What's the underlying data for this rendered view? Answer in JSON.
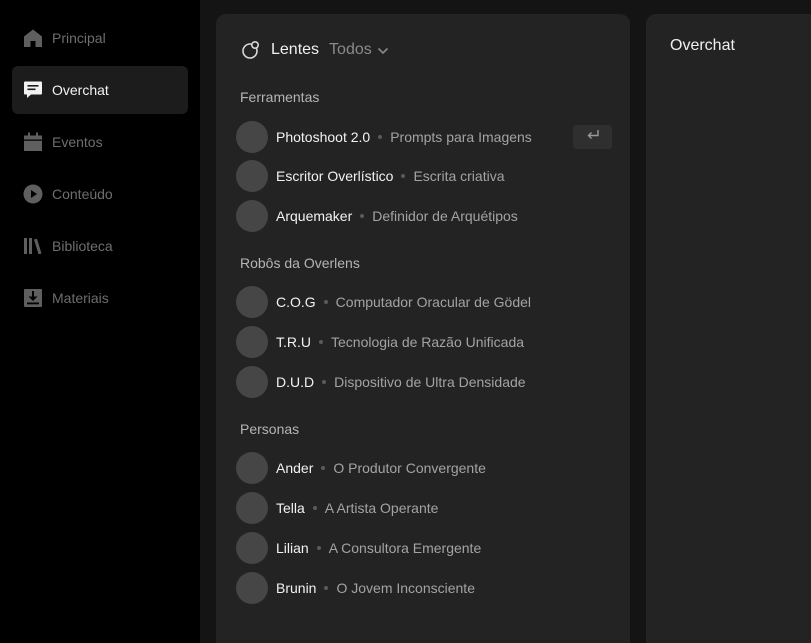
{
  "sidebar": {
    "items": [
      {
        "label": "Principal",
        "icon": "home-icon",
        "active": false
      },
      {
        "label": "Overchat",
        "icon": "chat-icon",
        "active": true
      },
      {
        "label": "Eventos",
        "icon": "calendar-icon",
        "active": false
      },
      {
        "label": "Conteúdo",
        "icon": "play-icon",
        "active": false
      },
      {
        "label": "Biblioteca",
        "icon": "library-icon",
        "active": false
      },
      {
        "label": "Materiais",
        "icon": "download-icon",
        "active": false
      }
    ]
  },
  "lentes": {
    "title": "Lentes",
    "filter": "Todos",
    "sections": [
      {
        "title": "Ferramentas",
        "items": [
          {
            "name": "Photoshoot 2.0",
            "desc": "Prompts para Imagens"
          },
          {
            "name": "Escritor Overlístico",
            "desc": "Escrita criativa"
          },
          {
            "name": "Arquemaker",
            "desc": "Definidor de Arquétipos"
          }
        ]
      },
      {
        "title": "Robôs da Overlens",
        "items": [
          {
            "name": "C.O.G",
            "desc": "Computador Oracular de Gödel"
          },
          {
            "name": "T.R.U",
            "desc": "Tecnologia de Razão Unificada"
          },
          {
            "name": "D.U.D",
            "desc": "Dispositivo de Ultra Densidade"
          }
        ]
      },
      {
        "title": "Personas",
        "items": [
          {
            "name": "Ander",
            "desc": "O Produtor Convergente"
          },
          {
            "name": "Tella",
            "desc": "A Artista Operante"
          },
          {
            "name": "Lilian",
            "desc": "A Consultora Emergente"
          },
          {
            "name": "Brunin",
            "desc": "O Jovem Inconsciente"
          }
        ]
      }
    ]
  },
  "chat": {
    "title": "Overchat"
  },
  "colors": {
    "sidebar_bg": "#000000",
    "main_bg": "#141414",
    "panel_bg": "#232323",
    "active_nav_bg": "#1c1c1c",
    "avatar": "#464646"
  }
}
